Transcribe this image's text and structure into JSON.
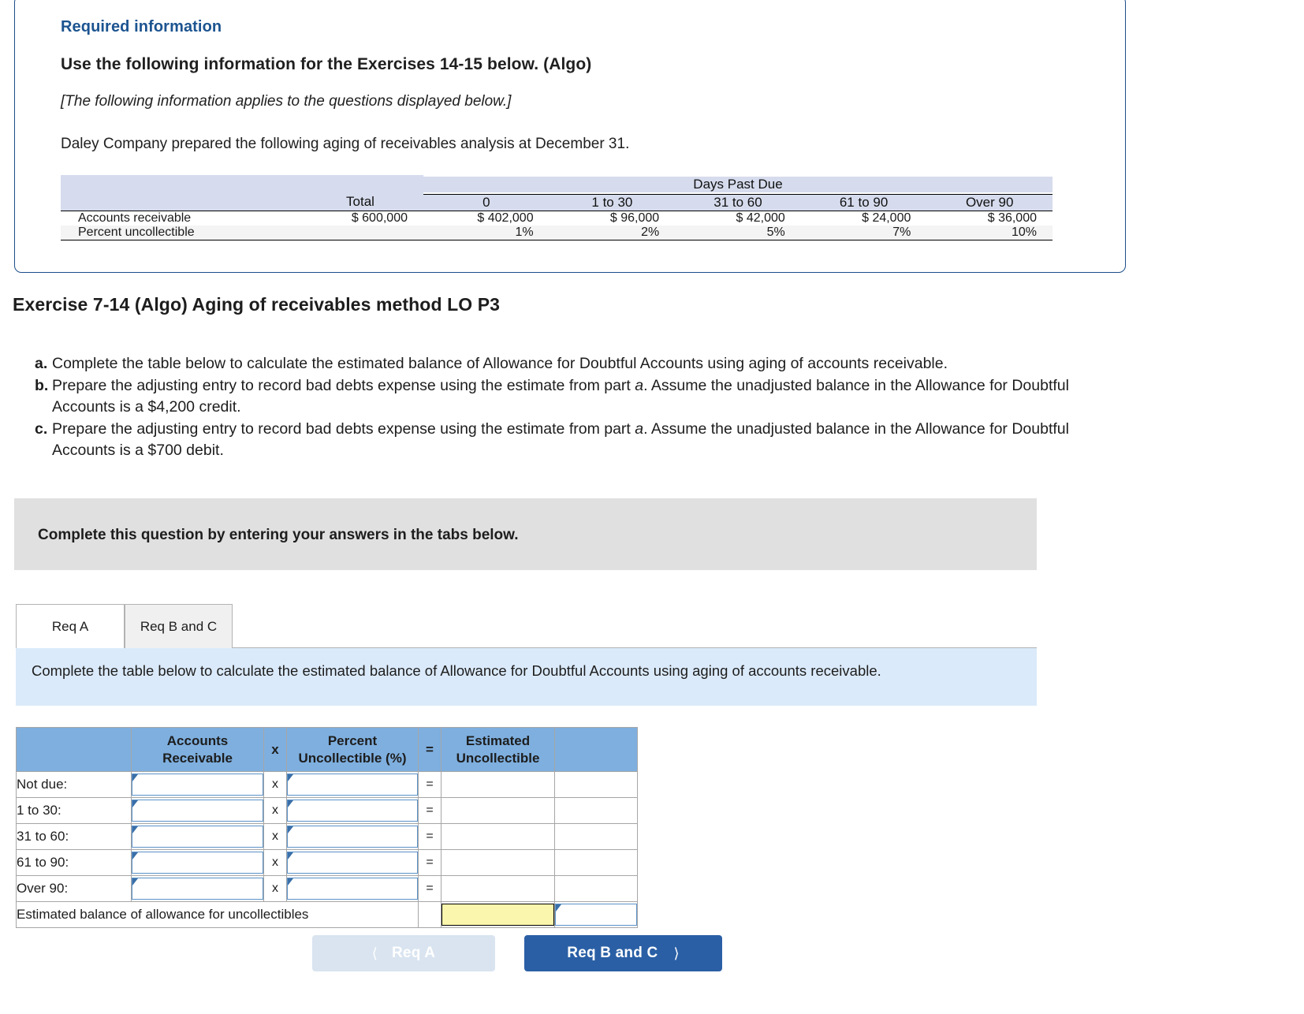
{
  "required_information": {
    "heading": "Required information",
    "subheading": "Use the following information for the Exercises 14-15 below. (Algo)",
    "applies_note": "[The following information applies to the questions displayed below.]",
    "intro": "Daley Company prepared the following aging of receivables analysis at December 31.",
    "aging_table": {
      "group_header": "Days Past Due",
      "columns": [
        "",
        "Total",
        "0",
        "1 to 30",
        "31 to 60",
        "61 to 90",
        "Over 90"
      ],
      "rows": [
        {
          "label": "Accounts receivable",
          "values": [
            "$ 600,000",
            "$ 402,000",
            "$ 96,000",
            "$ 42,000",
            "$ 24,000",
            "$ 36,000"
          ]
        },
        {
          "label": "Percent uncollectible",
          "values": [
            "",
            "1%",
            "2%",
            "5%",
            "7%",
            "10%"
          ]
        }
      ]
    }
  },
  "exercise": {
    "title": "Exercise 7-14 (Algo) Aging of receivables method LO P3",
    "requirements": [
      {
        "mark": "a.",
        "text": "Complete the table below to calculate the estimated balance of Allowance for Doubtful Accounts using aging of accounts receivable."
      },
      {
        "mark": "b.",
        "text_before": "Prepare the adjusting entry to record bad debts expense using the estimate from part ",
        "emph": "a",
        "text_after": ". Assume the unadjusted balance in the Allowance for Doubtful Accounts is a $4,200 credit."
      },
      {
        "mark": "c.",
        "text_before": "Prepare the adjusting entry to record bad debts expense using the estimate from part ",
        "emph": "a",
        "text_after": ". Assume the unadjusted balance in the Allowance for Doubtful Accounts is a $700 debit."
      }
    ]
  },
  "gray_instruction": "Complete this question by entering your answers in the tabs below.",
  "tabs": [
    {
      "label": "Req A",
      "active": true
    },
    {
      "label": "Req B and C",
      "active": false
    }
  ],
  "blue_instruction": "Complete the table below to calculate the estimated balance of Allowance for Doubtful Accounts using aging of accounts receivable.",
  "answer_table": {
    "headers": {
      "blank": "",
      "accounts_receivable": "Accounts Receivable",
      "times": "x",
      "percent_uncollectible": "Percent Uncollectible (%)",
      "equals": "=",
      "estimated_uncollectible": "Estimated Uncollectible",
      "tail": ""
    },
    "rows": [
      {
        "label": "Not due:",
        "ar": "",
        "op_x": "x",
        "pct": "",
        "op_eq": "=",
        "est": ""
      },
      {
        "label": "1 to 30:",
        "ar": "",
        "op_x": "x",
        "pct": "",
        "op_eq": "=",
        "est": ""
      },
      {
        "label": "31 to 60:",
        "ar": "",
        "op_x": "x",
        "pct": "",
        "op_eq": "=",
        "est": ""
      },
      {
        "label": "61 to 90:",
        "ar": "",
        "op_x": "x",
        "pct": "",
        "op_eq": "=",
        "est": ""
      },
      {
        "label": "Over 90:",
        "ar": "",
        "op_x": "x",
        "pct": "",
        "op_eq": "=",
        "est": ""
      }
    ],
    "total_row": {
      "label": "Estimated balance of allowance for uncollectibles",
      "value": ""
    }
  },
  "footer": {
    "prev_label": "Req A",
    "prev_icon": "chevron-left-icon",
    "next_label": "Req B and C",
    "next_icon": "chevron-right-icon"
  },
  "colors": {
    "panel_border": "#1c4e8a",
    "heading_blue": "#1c5490",
    "table_header_band": "#d6dced",
    "gray_bar": "#e0e0e0",
    "blue_bar": "#dbeafa",
    "answer_header_blue": "#7eafdf",
    "input_border_blue": "#5b92c8",
    "highlight_yellow": "#fbf6ad",
    "next_button_blue": "#2a5fa5",
    "prev_button_blue": "#d9e4f0"
  }
}
